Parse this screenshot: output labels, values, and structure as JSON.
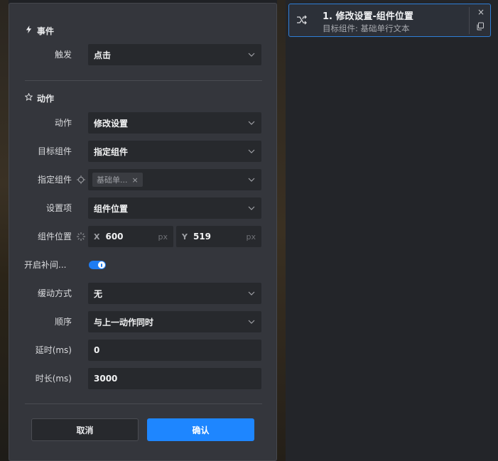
{
  "event_section": {
    "title": "事件",
    "trigger": {
      "label": "触发",
      "value": "点击"
    }
  },
  "action_section": {
    "title": "动作",
    "action": {
      "label": "动作",
      "value": "修改设置"
    },
    "target": {
      "label": "目标组件",
      "value": "指定组件"
    },
    "specified": {
      "label": "指定组件",
      "tag": "基础单...",
      "tag_close": "×"
    },
    "setting_item": {
      "label": "设置项",
      "value": "组件位置"
    },
    "position": {
      "label": "组件位置",
      "x_prefix": "X",
      "x_value": "600",
      "x_unit": "px",
      "y_prefix": "Y",
      "y_value": "519",
      "y_unit": "px"
    },
    "tween": {
      "label": "开启补间...",
      "enabled": true
    },
    "easing": {
      "label": "缓动方式",
      "value": "无"
    },
    "order": {
      "label": "顺序",
      "value": "与上一动作同时"
    },
    "delay": {
      "label": "延时(ms)",
      "value": "0"
    },
    "duration": {
      "label": "时长(ms)",
      "value": "3000"
    }
  },
  "buttons": {
    "cancel": "取消",
    "confirm": "确认"
  },
  "action_card": {
    "title": "1. 修改设置-组件位置",
    "subtitle": "目标组件: 基础单行文本",
    "close": "×"
  },
  "colors": {
    "accent": "#1e86ff",
    "panel_bg": "#34363c",
    "field_bg": "#27292d"
  },
  "icons": {
    "event": "lightning-icon",
    "action": "star-icon",
    "specified": "crosshair-icon",
    "position": "target-icon",
    "card": "shuffle-icon",
    "copy": "copy-icon"
  }
}
